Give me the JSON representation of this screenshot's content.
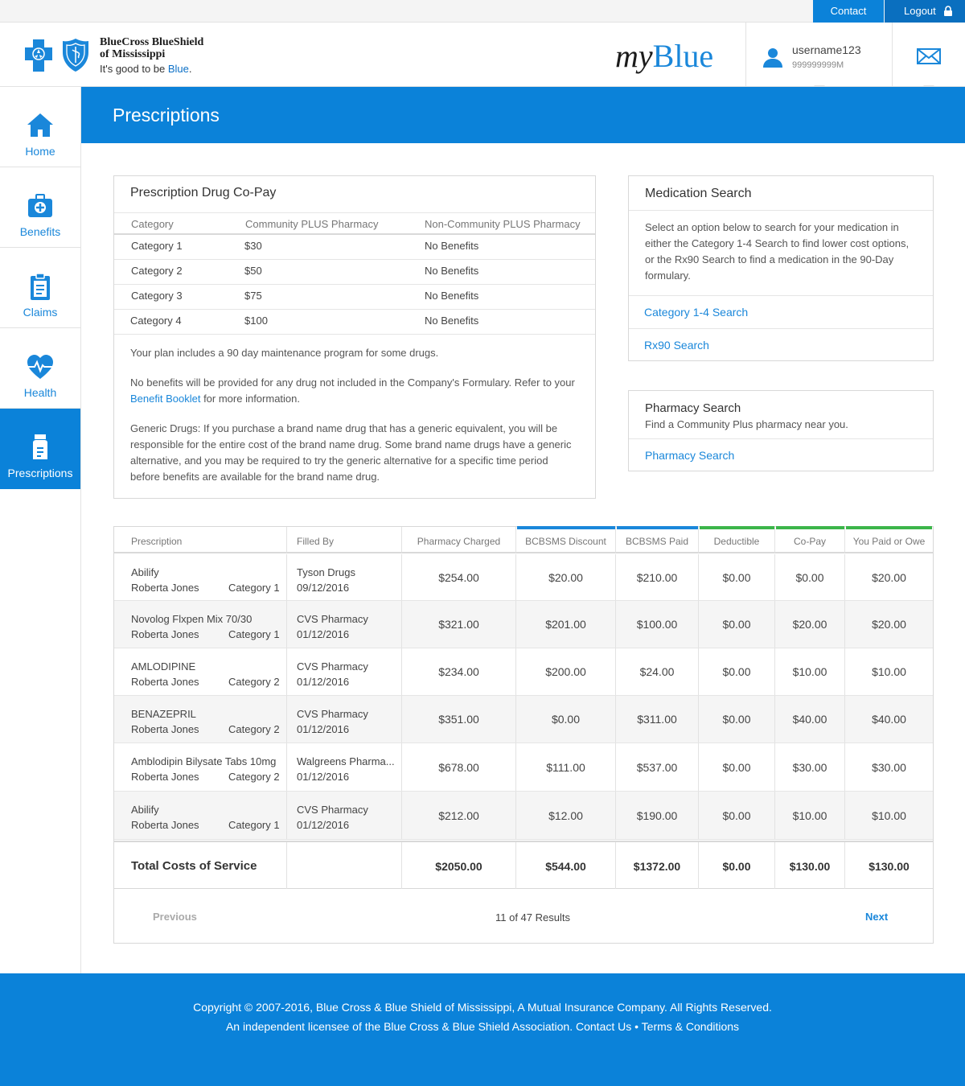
{
  "topbar": {
    "contact": "Contact",
    "logout": "Logout"
  },
  "brand": {
    "line1": "BlueCross BlueShield",
    "line2": "of Mississippi",
    "tagline_prefix": "It's good to be ",
    "tagline_blue": "Blue",
    "tagline_suffix": ".",
    "app_my": "my",
    "app_blue": "Blue"
  },
  "user": {
    "username": "username123",
    "member_id": "999999999M"
  },
  "sidebar": {
    "items": [
      {
        "label": "Home",
        "icon": "home-icon"
      },
      {
        "label": "Benefits",
        "icon": "briefcase-icon"
      },
      {
        "label": "Claims",
        "icon": "clipboard-icon"
      },
      {
        "label": "Health",
        "icon": "heart-pulse-icon"
      },
      {
        "label": "Prescriptions",
        "icon": "medicine-bottle-icon",
        "active": true
      }
    ]
  },
  "page": {
    "title": "Prescriptions"
  },
  "copay": {
    "title": "Prescription Drug Co-Pay",
    "headers": [
      "Category",
      "Community PLUS Pharmacy",
      "Non-Community PLUS Pharmacy"
    ],
    "rows": [
      [
        "Category 1",
        "$30",
        "No Benefits"
      ],
      [
        "Category 2",
        "$50",
        "No Benefits"
      ],
      [
        "Category 3",
        "$75",
        "No Benefits"
      ],
      [
        "Category 4",
        "$100",
        "No Benefits"
      ]
    ],
    "note1": "Your plan includes a 90 day maintenance program for some drugs.",
    "note2_pre": "No benefits will be provided for any drug not included in the Company's Formulary. Refer to your ",
    "note2_link": "Benefit Booklet",
    "note2_post": " for more information.",
    "note3": "Generic Drugs: If you purchase a brand name drug that has a generic equivalent, you will be responsible for the entire cost of the brand name drug. Some brand name drugs have a generic alternative, and you may be required to try the generic alternative for a specific time period before benefits are available for the brand name drug."
  },
  "medsearch": {
    "title": "Medication Search",
    "description": "Select an option below to search for your medication in either the Category 1-4 Search to find lower cost options, or the Rx90 Search to find a medication in the 90-Day formulary.",
    "link1": "Category 1-4 Search",
    "link2": "Rx90 Search"
  },
  "pharmacy": {
    "title": "Pharmacy Search",
    "subtitle": "Find a Community Plus pharmacy near you.",
    "link": "Pharmacy Search"
  },
  "claims": {
    "headers": [
      "Prescription",
      "Filled By",
      "Pharmacy  Charged",
      "BCBSMS Discount",
      "BCBSMS Paid",
      "Deductible",
      "Co-Pay",
      "You Paid or Owe"
    ],
    "header_bar_colors": {
      "blue": "#1a87da",
      "green": "#3cb54a"
    },
    "rows": [
      {
        "drug": "Abilify",
        "member": "Roberta Jones",
        "category": "Category 1",
        "pharmacy": "Tyson Drugs",
        "date": "09/12/2016",
        "charged": "$254.00",
        "discount": "$20.00",
        "paid": "$210.00",
        "deductible": "$0.00",
        "copay": "$0.00",
        "owe": "$20.00"
      },
      {
        "drug": "Novolog Flxpen Mix 70/30",
        "member": "Roberta Jones",
        "category": "Category 1",
        "pharmacy": "CVS Pharmacy",
        "date": "01/12/2016",
        "charged": "$321.00",
        "discount": "$201.00",
        "paid": "$100.00",
        "deductible": "$0.00",
        "copay": "$20.00",
        "owe": "$20.00"
      },
      {
        "drug": "AMLODIPINE",
        "member": "Roberta Jones",
        "category": "Category 2",
        "pharmacy": "CVS Pharmacy",
        "date": "01/12/2016",
        "charged": "$234.00",
        "discount": "$200.00",
        "paid": "$24.00",
        "deductible": "$0.00",
        "copay": "$10.00",
        "owe": "$10.00"
      },
      {
        "drug": "BENAZEPRIL",
        "member": "Roberta Jones",
        "category": "Category 2",
        "pharmacy": "CVS Pharmacy",
        "date": "01/12/2016",
        "charged": "$351.00",
        "discount": "$0.00",
        "paid": "$311.00",
        "deductible": "$0.00",
        "copay": "$40.00",
        "owe": "$40.00"
      },
      {
        "drug": "Amblodipin Bilysate Tabs 10mg",
        "member": "Roberta Jones",
        "category": "Category 2",
        "pharmacy": "Walgreens Pharma...",
        "date": "01/12/2016",
        "charged": "$678.00",
        "discount": "$111.00",
        "paid": "$537.00",
        "deductible": "$0.00",
        "copay": "$30.00",
        "owe": "$30.00"
      },
      {
        "drug": "Abilify",
        "member": "Roberta Jones",
        "category": "Category 1",
        "pharmacy": "CVS Pharmacy",
        "date": "01/12/2016",
        "charged": "$212.00",
        "discount": "$12.00",
        "paid": "$190.00",
        "deductible": "$0.00",
        "copay": "$10.00",
        "owe": "$10.00"
      }
    ],
    "totals": {
      "label": "Total Costs of Service",
      "charged": "$2050.00",
      "discount": "$544.00",
      "paid": "$1372.00",
      "deductible": "$0.00",
      "copay": "$130.00",
      "owe": "$130.00"
    },
    "pager": {
      "previous": "Previous",
      "count": "11 of 47 Results",
      "next": "Next"
    }
  },
  "footer": {
    "line1": "Copyright © 2007-2016, Blue Cross & Blue Shield of Mississippi, A Mutual Insurance Company. All Rights Reserved.",
    "line2": "An independent licensee of the Blue Cross & Blue Shield Association. Contact Us • Terms & Conditions"
  }
}
